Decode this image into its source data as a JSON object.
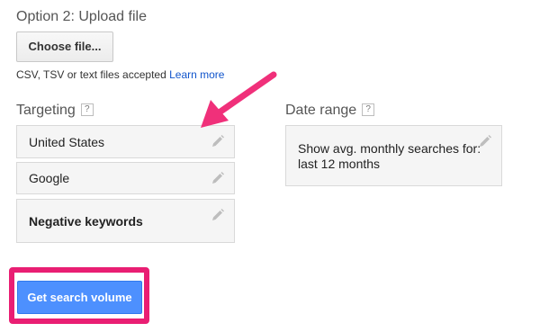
{
  "upload": {
    "title": "Option 2: Upload file",
    "choose_button": "Choose file...",
    "accepted_note": "CSV, TSV or text files accepted",
    "learn_more": "Learn more"
  },
  "targeting": {
    "title": "Targeting",
    "help": "?",
    "location": "United States",
    "network": "Google",
    "negative_keywords": "Negative keywords"
  },
  "date_range": {
    "title": "Date range",
    "help": "?",
    "value": "Show avg. monthly searches for: last 12 months"
  },
  "actions": {
    "get_search_volume": "Get search volume"
  },
  "annotations": {
    "arrow_color": "#f0307a",
    "highlight_color": "#e91e73"
  }
}
